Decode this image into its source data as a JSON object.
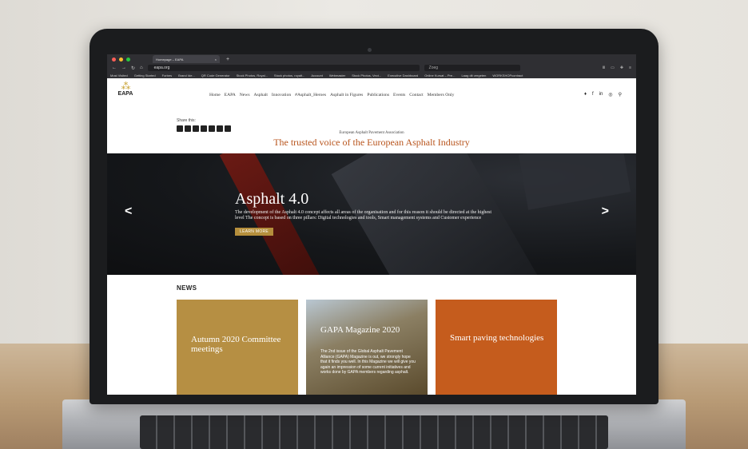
{
  "browser": {
    "tab_title": "Homepage – EAPA",
    "url": "eapa.org",
    "search_placeholder": "Zoeg",
    "bookmarks": [
      "Most Visited",
      "Getting Started",
      "Forbes",
      "Brand Ide...",
      "QR Code Generator",
      "Stock Photos, Royal...",
      "Stock photos, royalt...",
      "Account",
      "Webmaster",
      "Stock Photos, Vect...",
      "Executive Dashboard",
      "Online Kursat – Pre...",
      "Laag dit vergeten",
      "WORKSHOPcontract"
    ]
  },
  "site": {
    "logo_text": "EAPA",
    "nav": [
      "Home",
      "EAPA",
      "News",
      "Asphalt",
      "Innovation",
      "#Asphalt_Heroes",
      "Asphalt in Figures",
      "Publications",
      "Events",
      "Contact",
      "Members Only"
    ],
    "social_icons": [
      "twitter-icon",
      "facebook-icon",
      "linkedin-icon",
      "instagram-icon",
      "search-icon"
    ],
    "share_label": "Share this:",
    "association": "European Asphalt Pavement Association",
    "tagline": "The trusted voice of the European Asphalt Industry",
    "accent_color": "#b8541c",
    "gold_color": "#b68f43"
  },
  "hero": {
    "title": "Asphalt 4.0",
    "text": "The development of the Asphalt 4.0 concept affects all areas of the organisation and for this reason it should be directed at the highest level The concept is based on three pillars: Digital technologies and tools, Smart management systems and Customer experience",
    "button": "LEARN MORE"
  },
  "news": {
    "heading": "NEWS",
    "cards": [
      {
        "title": "Autumn 2020 Committee meetings",
        "text": ""
      },
      {
        "title": "GAPA Magazine 2020",
        "text": "The 2nd issue of the Global Asphalt Pavement Alliance (GAPA) Magazine is out, we strongly hope that it finds you well. In this Magazine we will give you again an impression of some current initiatives and works done by GAPA members regarding asphalt."
      },
      {
        "title": "Smart paving technologies",
        "text": ""
      }
    ]
  }
}
